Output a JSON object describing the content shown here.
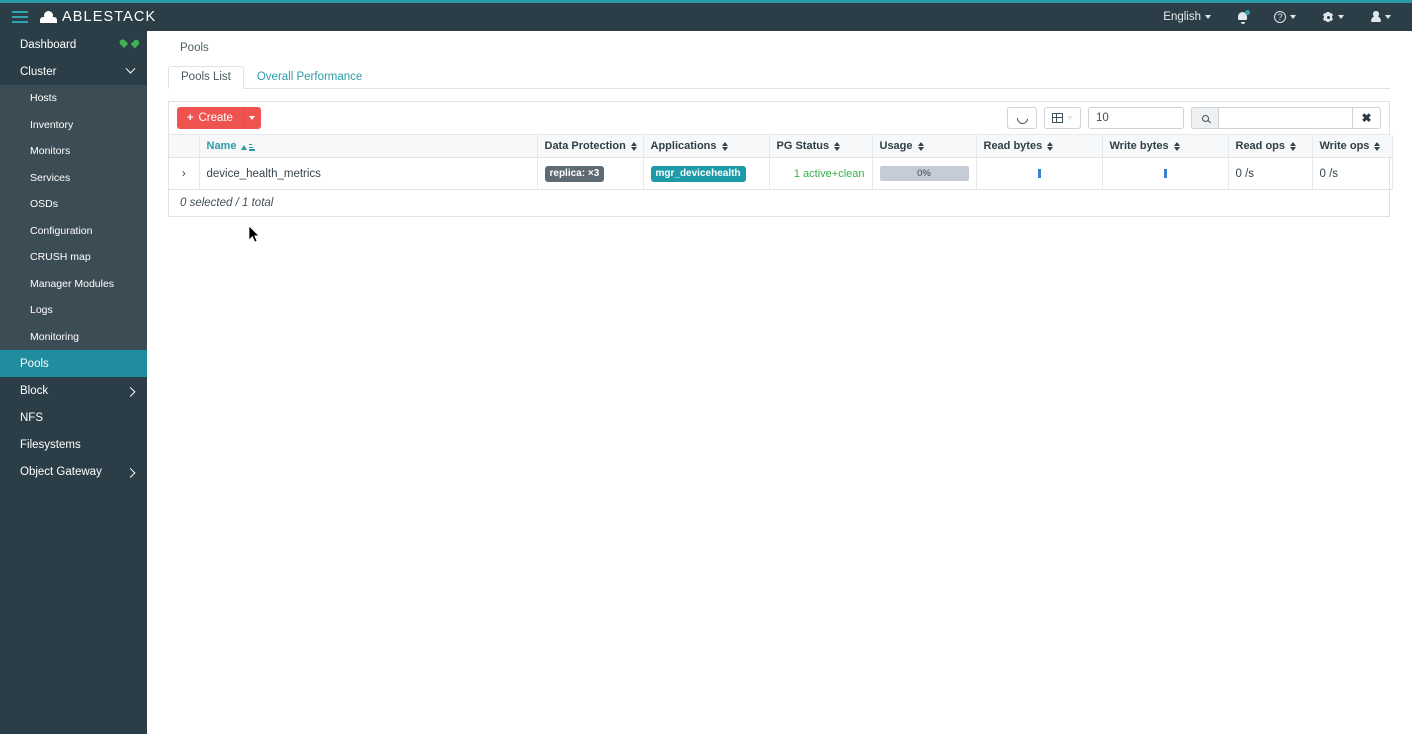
{
  "header": {
    "menu_icon": "hamburger-icon",
    "brand": "ABLESTACK",
    "language": "English",
    "notifications_icon": "bell-icon",
    "help_icon": "question-circle-icon",
    "settings_icon": "gear-icon",
    "user_icon": "user-icon"
  },
  "sidebar": {
    "items": [
      {
        "label": "Dashboard",
        "icon": "heart-icon",
        "level": "top",
        "state": "normal"
      },
      {
        "label": "Cluster",
        "icon": "chevron-down-icon",
        "level": "top",
        "state": "expanded"
      },
      {
        "label": "Hosts",
        "level": "sub",
        "state": "normal"
      },
      {
        "label": "Inventory",
        "level": "sub",
        "state": "normal"
      },
      {
        "label": "Monitors",
        "level": "sub",
        "state": "normal"
      },
      {
        "label": "Services",
        "level": "sub",
        "state": "normal"
      },
      {
        "label": "OSDs",
        "level": "sub",
        "state": "normal"
      },
      {
        "label": "Configuration",
        "level": "sub",
        "state": "normal"
      },
      {
        "label": "CRUSH map",
        "level": "sub",
        "state": "normal"
      },
      {
        "label": "Manager Modules",
        "level": "sub",
        "state": "normal"
      },
      {
        "label": "Logs",
        "level": "sub",
        "state": "normal"
      },
      {
        "label": "Monitoring",
        "level": "sub",
        "state": "normal"
      },
      {
        "label": "Pools",
        "level": "top",
        "state": "active"
      },
      {
        "label": "Block",
        "icon": "chevron-right-icon",
        "level": "top",
        "state": "collapsed"
      },
      {
        "label": "NFS",
        "level": "top",
        "state": "normal"
      },
      {
        "label": "Filesystems",
        "level": "top",
        "state": "normal"
      },
      {
        "label": "Object Gateway",
        "icon": "chevron-right-icon",
        "level": "top",
        "state": "collapsed"
      }
    ]
  },
  "main": {
    "breadcrumb": "Pools",
    "tabs": [
      {
        "label": "Pools List",
        "active": true
      },
      {
        "label": "Overall Performance",
        "active": false
      }
    ],
    "toolbar": {
      "create_label": "Create",
      "create_plus": "+",
      "refresh_icon": "refresh-icon",
      "columns_icon": "table-columns-icon",
      "page_size_value": "10",
      "search_icon": "search-icon",
      "search_value": "",
      "clear_label": "✖"
    },
    "table": {
      "columns": [
        {
          "label": "Name",
          "sort": "asc"
        },
        {
          "label": "Data Protection",
          "sort": "none"
        },
        {
          "label": "Applications",
          "sort": "none"
        },
        {
          "label": "PG Status",
          "sort": "none"
        },
        {
          "label": "Usage",
          "sort": "none"
        },
        {
          "label": "Read bytes",
          "sort": "none"
        },
        {
          "label": "Write bytes",
          "sort": "none"
        },
        {
          "label": "Read ops",
          "sort": "none"
        },
        {
          "label": "Write ops",
          "sort": "none"
        }
      ],
      "rows": [
        {
          "expander": "›",
          "name": "device_health_metrics",
          "data_protection": "replica: ×3",
          "applications": "mgr_devicehealth",
          "pg_status": "1 active+clean",
          "usage": "0%",
          "usage_percent": 0,
          "read_bytes": "",
          "write_bytes": "",
          "read_ops": "0 /s",
          "write_ops": "0 /s"
        }
      ],
      "footer": "0 selected / 1 total"
    }
  },
  "colors": {
    "header_bg": "#2b3d46",
    "accent_teal": "#2b9ba8",
    "sidebar_active": "#1f8d9e",
    "create_red": "#ef5350",
    "badge_gray": "#5f6b72",
    "badge_teal": "#1c9aa8",
    "pg_green": "#32b14b",
    "usage_bar": "#c6ccd6",
    "spark_blue": "#3a7fd0",
    "heart_green": "#3fb34f"
  }
}
